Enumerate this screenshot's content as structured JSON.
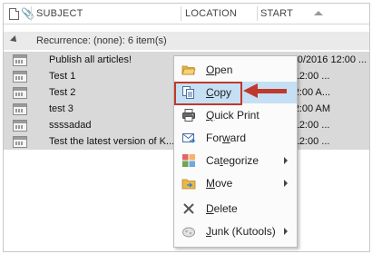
{
  "columns": {
    "subject": "SUBJECT",
    "location": "LOCATION",
    "start": "START"
  },
  "group": {
    "label": "Recurrence: (none): 6 item(s)"
  },
  "rows": [
    {
      "subject": "Publish all articles!",
      "start": "Wed 3/30/2016 12:00 ..."
    },
    {
      "subject": "Test 1",
      "start": "1/2016 12:00 ..."
    },
    {
      "subject": "Test 2",
      "start": "/2016 12:00 A..."
    },
    {
      "subject": "test 3",
      "start": "/2016 12:00 AM"
    },
    {
      "subject": "ssssadad",
      "start": "5/2016 12:00 ..."
    },
    {
      "subject": "Test the latest version of K...",
      "start": "7/2016 12:00 ..."
    }
  ],
  "context_menu": {
    "items": [
      {
        "icon": "folder-open-icon",
        "label": "Open"
      },
      {
        "icon": "copy-icon",
        "label": "Copy"
      },
      {
        "icon": "printer-icon",
        "label": "Quick Print"
      },
      {
        "icon": "forward-icon",
        "label": "Forward"
      },
      {
        "icon": "categorize-icon",
        "label": "Categorize"
      },
      {
        "icon": "move-folder-icon",
        "label": "Move"
      },
      {
        "icon": "delete-x-icon",
        "label": "Delete"
      },
      {
        "icon": "junk-icon",
        "label": "Junk (Kutools)"
      }
    ]
  },
  "colors": {
    "selection": "#d9d9d9",
    "group_bg": "#eaeaea",
    "menu_highlight": "#c5e0f5",
    "annotation_red": "#c0392b"
  }
}
